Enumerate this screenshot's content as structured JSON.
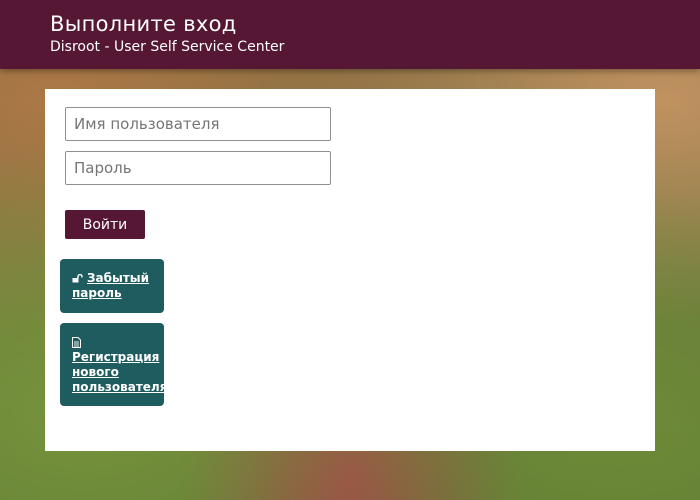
{
  "header": {
    "title": "Выполните вход",
    "subtitle": "Disroot - User Self Service Center"
  },
  "login_form": {
    "username_placeholder": "Имя пользователя",
    "password_placeholder": "Пароль",
    "submit_label": "Войти"
  },
  "actions": {
    "forgot_password": {
      "icon": "unlock-icon",
      "line1": "Забытый",
      "line2": "пароль"
    },
    "register": {
      "icon": "document-icon",
      "line1": "Регистрация",
      "line2": "нового",
      "line3": "пользователя"
    }
  },
  "colors": {
    "brand": "#551733",
    "action": "#1f5c5f",
    "card": "#ffffff"
  }
}
